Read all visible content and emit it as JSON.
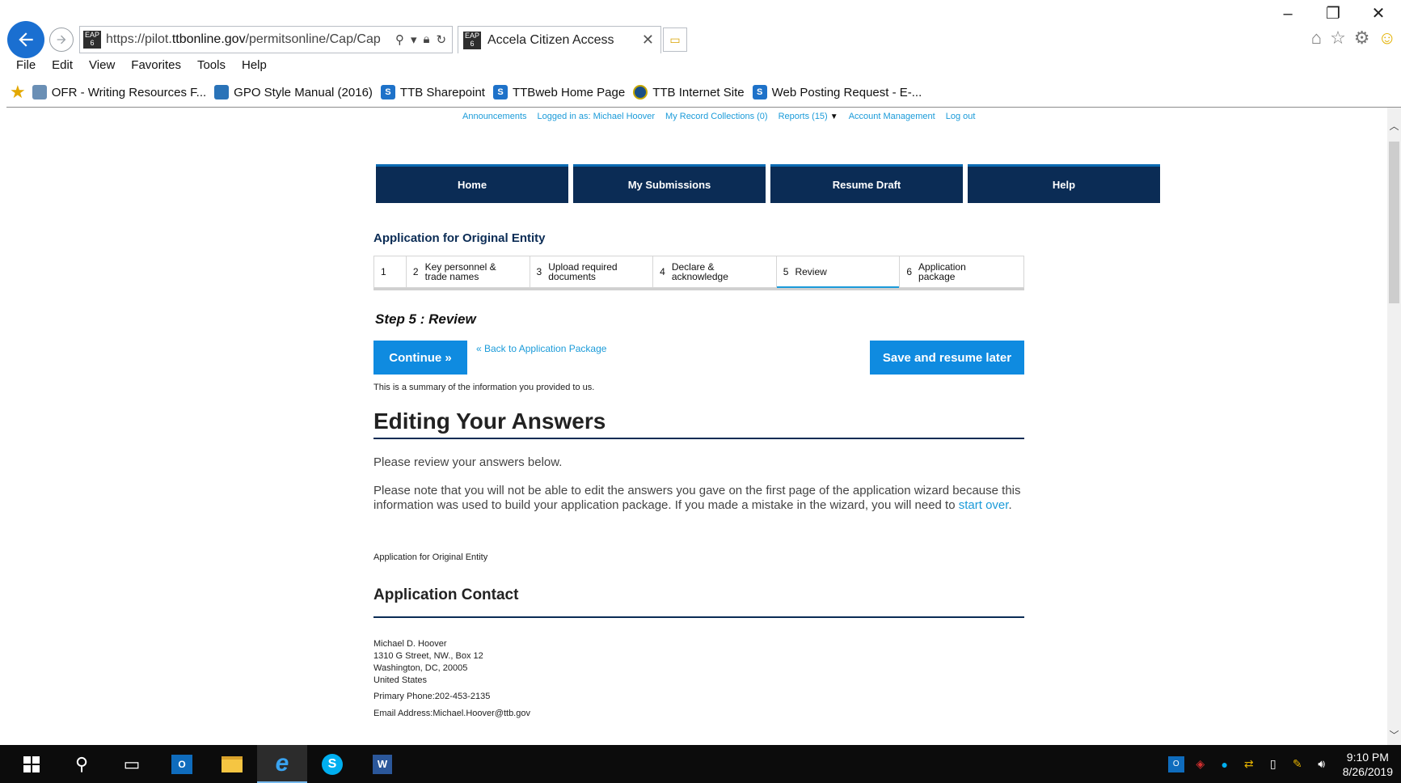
{
  "browser": {
    "url_prefix": "https://pilot.",
    "url_domain": "ttbonline.gov",
    "url_path": "/permitsonline/Cap/Cap",
    "tab_title": "Accela Citizen Access",
    "favicon_text": "EAP 6",
    "menu": [
      "File",
      "Edit",
      "View",
      "Favorites",
      "Tools",
      "Help"
    ],
    "favorites": [
      "OFR - Writing Resources F...",
      "GPO Style Manual (2016)",
      "TTB Sharepoint",
      "TTBweb Home Page",
      "TTB Internet Site",
      "Web Posting Request - E-..."
    ]
  },
  "toplinks": {
    "announcements": "Announcements",
    "logged_in": "Logged in as: Michael Hoover",
    "collections": "My Record Collections (0)",
    "reports": "Reports (15)",
    "account": "Account Management",
    "logout": "Log out"
  },
  "nav": [
    "Home",
    "My Submissions",
    "Resume Draft",
    "Help"
  ],
  "app_title": "Application for Original Entity",
  "steps": [
    {
      "num": "1",
      "label": ""
    },
    {
      "num": "2",
      "label": "Key personnel & trade names"
    },
    {
      "num": "3",
      "label": "Upload required documents"
    },
    {
      "num": "4",
      "label": "Declare & acknowledge"
    },
    {
      "num": "5",
      "label": "Review"
    },
    {
      "num": "6",
      "label": "Application package"
    }
  ],
  "step_heading": "Step 5 : Review",
  "buttons": {
    "continue": "Continue »",
    "back": "« Back to Application Package",
    "save": "Save and resume later"
  },
  "summary_note": "This is a summary of the information you provided to us.",
  "editing_heading": "Editing Your Answers",
  "review_text": "Please review your answers below.",
  "note_text": "Please note that you will not be able to edit the answers you gave on the first page of the application wizard because this information was used to build your application package. If you made a mistake in the wizard, you will need to ",
  "note_link": "start over",
  "note_end": ".",
  "app_label": "Application for Original Entity",
  "contact": {
    "heading": "Application Contact",
    "name": "Michael D. Hoover",
    "street": "1310 G Street, NW., Box 12",
    "city": "Washington, DC, 20005",
    "country": "United States",
    "phone": "Primary Phone:202-453-2135",
    "email": "Email Address:Michael.Hoover@ttb.gov"
  },
  "taskbar": {
    "time": "9:10 PM",
    "date": "8/26/2019"
  },
  "colors": {
    "nav_bg": "#0b2c55",
    "accent": "#0f8be0",
    "link": "#1b9bd9"
  }
}
